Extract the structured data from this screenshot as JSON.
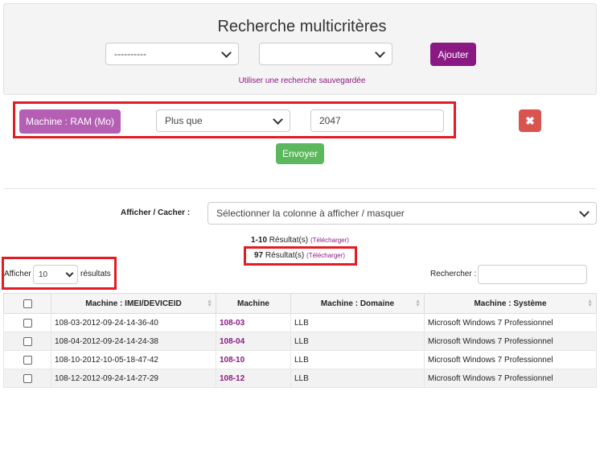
{
  "search": {
    "title": "Recherche multicritères",
    "field_select_value": "----------",
    "second_select_value": "",
    "add_label": "Ajouter",
    "saved_search_link": "Utiliser une recherche sauvegardée"
  },
  "criteria": {
    "field_label": "Machine : RAM (Mo)",
    "operator": "Plus que",
    "value": "2047",
    "delete_icon": "close-icon",
    "send_label": "Envoyer"
  },
  "columns_toggle": {
    "label": "Afficher / Cacher :",
    "placeholder": "Sélectionner la colonne à afficher / masquer"
  },
  "results": {
    "range": "1-10",
    "range_suffix": "Résultat(s)",
    "total": "97",
    "total_suffix": "Résultat(s)",
    "download_label": "(Télécharger)"
  },
  "page_size": {
    "prefix": "Afficher",
    "value": "10",
    "suffix": "résultats"
  },
  "table_search": {
    "label": "Rechercher :",
    "value": ""
  },
  "table": {
    "headers": [
      "Machine : IMEI/DEVICEID",
      "Machine",
      "Machine : Domaine",
      "Machine : Système"
    ],
    "rows": [
      [
        "108-03-2012-09-24-14-36-40",
        "108-03",
        "LLB",
        "Microsoft Windows 7 Professionnel"
      ],
      [
        "108-04-2012-09-24-14-24-38",
        "108-04",
        "LLB",
        "Microsoft Windows 7 Professionnel"
      ],
      [
        "108-10-2012-10-05-18-47-42",
        "108-10",
        "LLB",
        "Microsoft Windows 7 Professionnel"
      ],
      [
        "108-12-2012-09-24-14-27-29",
        "108-12",
        "LLB",
        "Microsoft Windows 7 Professionnel"
      ]
    ]
  },
  "colors": {
    "accent": "#8a1a83",
    "tag": "#b55fb4",
    "danger": "#d9534f",
    "success": "#5cb85c",
    "highlight": "#e21c24"
  }
}
